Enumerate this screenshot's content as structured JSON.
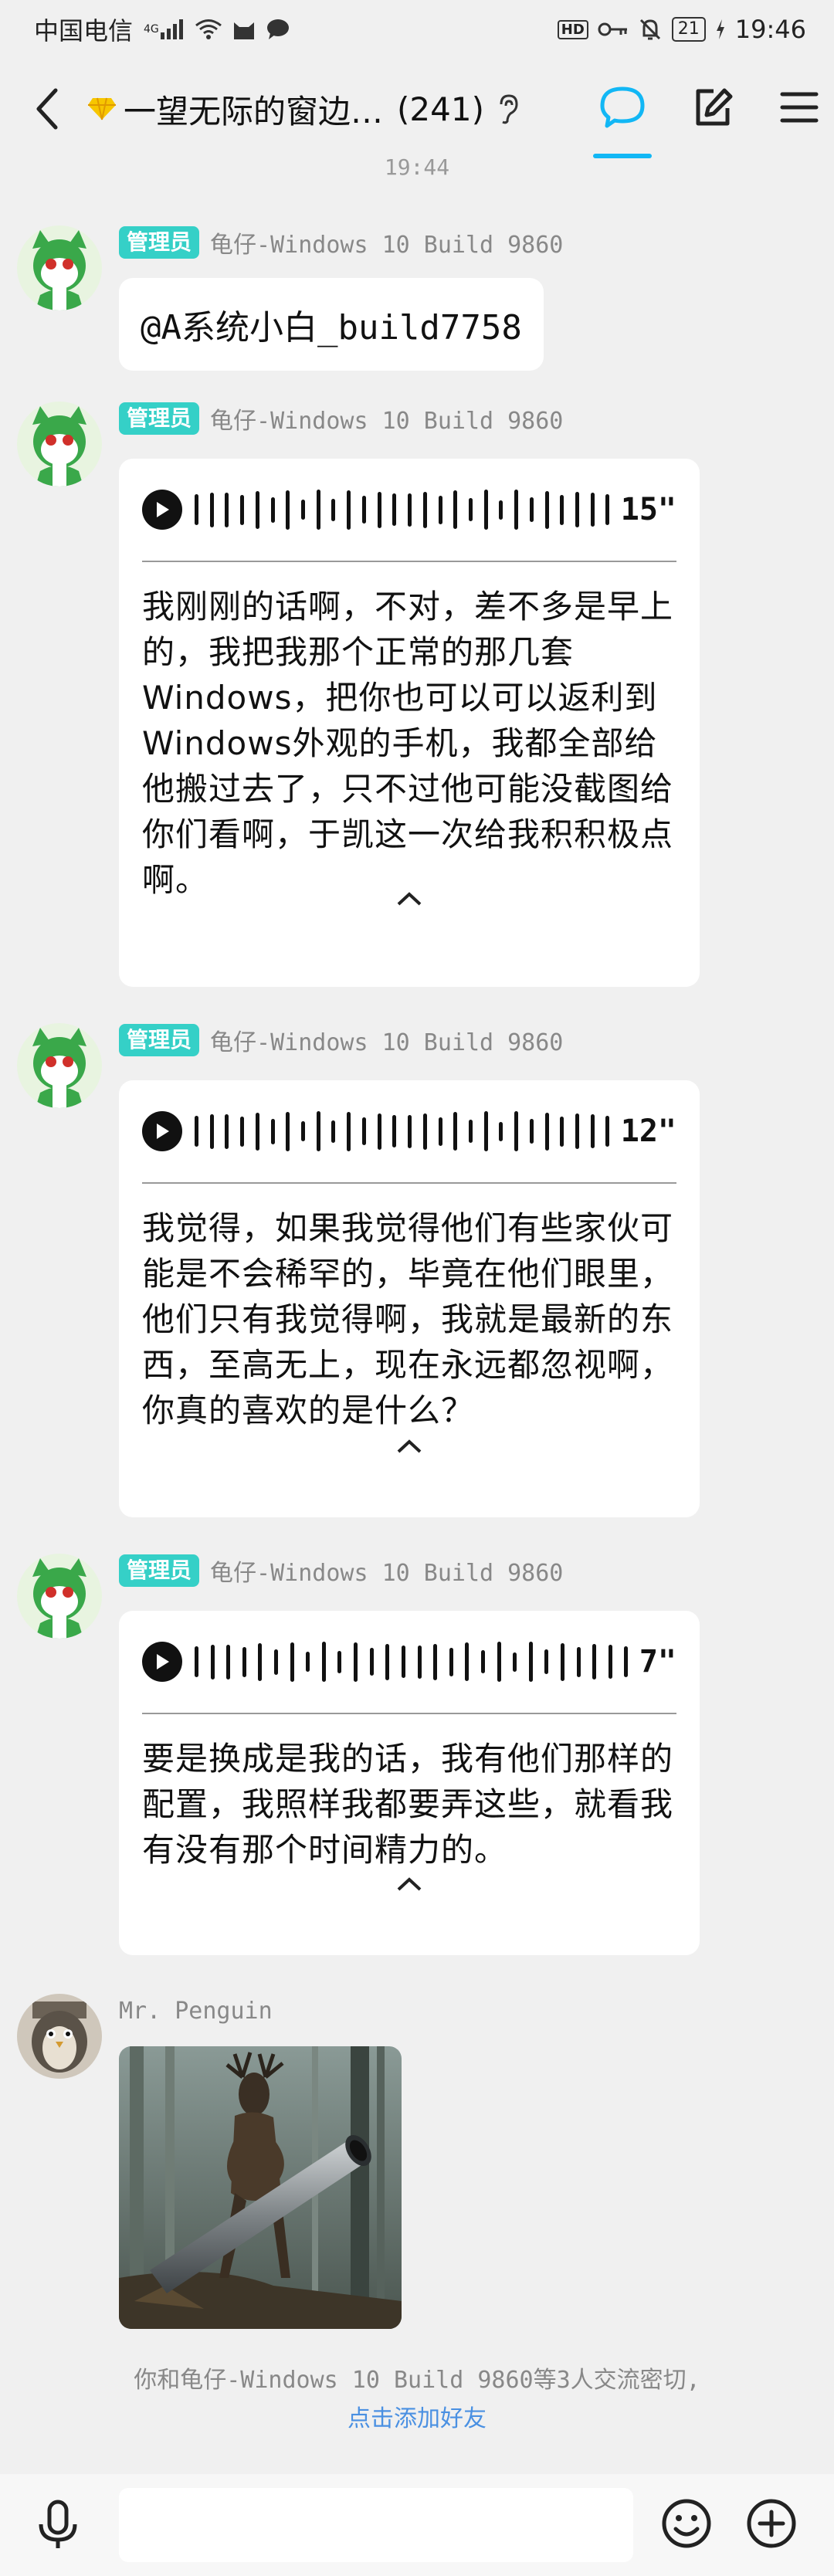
{
  "status_bar": {
    "carrier": "中国电信",
    "network_type": "4G",
    "battery": "21",
    "time": "19:46",
    "hd_label": "HD"
  },
  "header": {
    "group_title": "一望无际的窗边…",
    "member_count": "(241)",
    "title_icon": "diamond-icon"
  },
  "time_divider": "19:44",
  "messages": [
    {
      "badge": "管理员",
      "sender": "龟仔-Windows 10 Build 9860",
      "type": "text",
      "text": "@A系统小白_build7758"
    },
    {
      "badge": "管理员",
      "sender": "龟仔-Windows 10 Build 9860",
      "type": "voice",
      "duration": "15\"",
      "transcript": "我刚刚的话啊，不对，差不多是早上的，我把我那个正常的那几套Windows，把你也可以可以返利到Windows外观的手机，我都全部给他搬过去了，只不过他可能没截图给你们看啊，于凯这一次给我积积极点啊。"
    },
    {
      "badge": "管理员",
      "sender": "龟仔-Windows 10 Build 9860",
      "type": "voice",
      "duration": "12\"",
      "transcript": "我觉得，如果我觉得他们有些家伙可能是不会稀罕的，毕竟在他们眼里，他们只有我觉得啊，我就是最新的东西，至高无上，现在永远都忽视啊，你真的喜欢的是什么？"
    },
    {
      "badge": "管理员",
      "sender": "龟仔-Windows 10 Build 9860",
      "type": "voice",
      "duration": "7\"",
      "transcript": "要是换成是我的话，我有他们那样的配置，我照样我都要弄这些，就看我有没有那个时间精力的。"
    },
    {
      "sender": "Mr. Penguin",
      "type": "image",
      "image_desc": "deer-carrying-pipe-image"
    }
  ],
  "friend_hint": {
    "text": "你和龟仔-Windows 10 Build 9860等3人交流密切,",
    "link": "点击添加好友"
  },
  "colors": {
    "accent": "#12b7f5",
    "admin_badge": "#35d0c7",
    "link": "#4a90e2"
  }
}
